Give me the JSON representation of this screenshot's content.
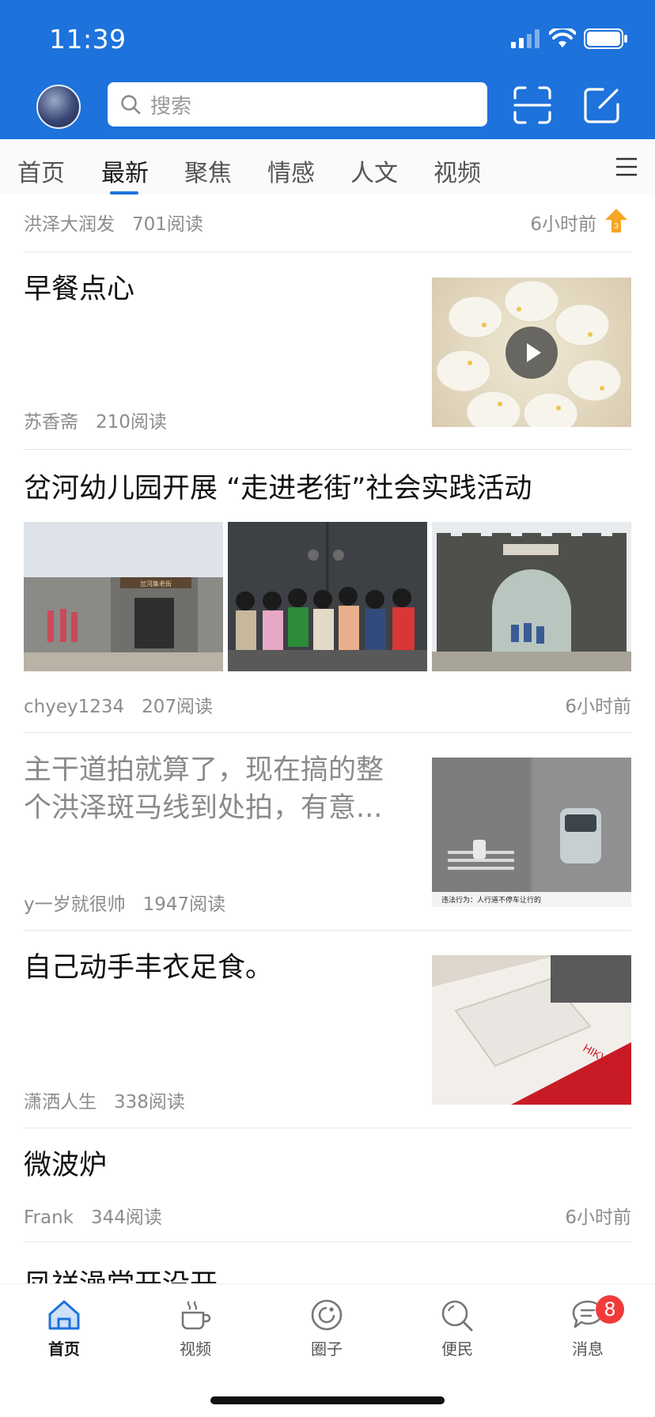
{
  "status_bar": {
    "time": "11:39"
  },
  "header": {
    "search_placeholder": "搜索"
  },
  "tabs": [
    {
      "label": "首页"
    },
    {
      "label": "最新"
    },
    {
      "label": "聚焦"
    },
    {
      "label": "情感"
    },
    {
      "label": "人文"
    },
    {
      "label": "视频"
    }
  ],
  "feed": {
    "top_partial": {
      "author": "洪泽大润发",
      "reads": "701阅读",
      "time": "6小时前"
    },
    "items": [
      {
        "title": "早餐点心",
        "author": "苏香斋",
        "reads": "210阅读"
      },
      {
        "title": "岔河幼儿园开展 “走进老街”社会实践活动",
        "author": "chyey1234",
        "reads": "207阅读",
        "time": "6小时前",
        "image_text": "岔河集老街"
      },
      {
        "title_line1": "主干道拍就算了，现在搞的整",
        "title_line2": "个洪泽斑马线到处拍，有意...",
        "author": "y一岁就很帅",
        "reads": "1947阅读",
        "image_caption": "违法行为：人行道不停车让行的"
      },
      {
        "title": "自己动手丰衣足食。",
        "author": "潇洒人生",
        "reads": "338阅读",
        "image_brand": "HIKVISION"
      },
      {
        "title": "微波炉",
        "author": "Frank",
        "reads": "344阅读",
        "time": "6小时前"
      },
      {
        "title": "凤祥澡堂开没开"
      }
    ]
  },
  "bottom_nav": [
    {
      "label": "首页",
      "icon": "home-icon"
    },
    {
      "label": "视频",
      "icon": "coffee-cup-icon"
    },
    {
      "label": "圈子",
      "icon": "circle-icon"
    },
    {
      "label": "便民",
      "icon": "search-icon"
    },
    {
      "label": "消息",
      "icon": "chat-icon",
      "badge": "8"
    }
  ],
  "colors": {
    "brand": "#1d72db",
    "badge": "#f03b3b",
    "hot": "#f5a623"
  }
}
